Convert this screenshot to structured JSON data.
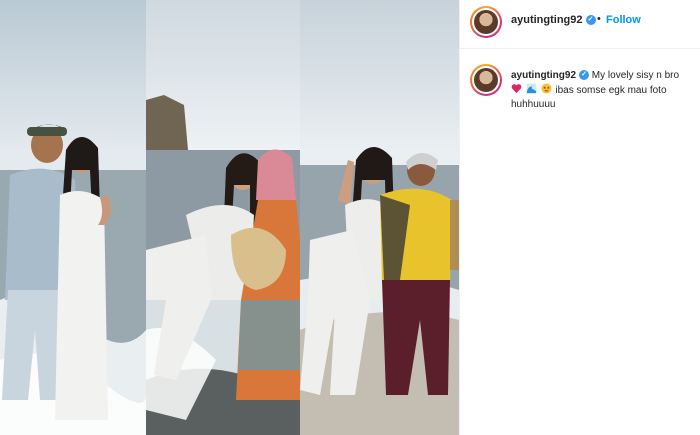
{
  "post": {
    "username": "ayutingting92",
    "follow_label": "Follow",
    "separator": "•",
    "verified_symbol": "✓",
    "caption_part1": "My lovely sisy n bro",
    "caption_part2": "ibas somse egk mau foto huhhuuuu",
    "emojis": [
      "red-heart-emoji",
      "wave-emoji",
      "star-struck-emoji"
    ]
  },
  "colors": {
    "follow": "#0095f6",
    "verified": "#3897f0",
    "text": "#262626",
    "border": "#efefef"
  }
}
